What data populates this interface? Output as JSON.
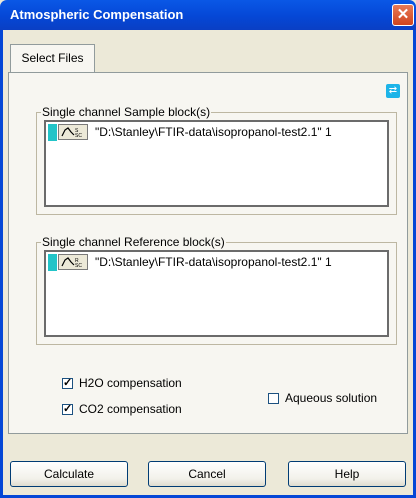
{
  "window": {
    "title": "Atmospheric Compensation",
    "close_glyph": "✕"
  },
  "tabs": [
    {
      "label": "Select Files",
      "active": true
    }
  ],
  "sample_group": {
    "label": "Single channel Sample block(s)",
    "item": {
      "block_letters": "SSC",
      "text": "\"D:\\Stanley\\FTIR-data\\isopropanol-test2.1\" 1"
    }
  },
  "reference_group": {
    "label": "Single channel Reference block(s)",
    "item": {
      "block_letters": "RSC",
      "text": "\"D:\\Stanley\\FTIR-data\\isopropanol-test2.1\" 1"
    }
  },
  "options": {
    "h2o": {
      "label": "H2O compensation",
      "checked": true
    },
    "co2": {
      "label": "CO2 compensation",
      "checked": true
    },
    "aqueous": {
      "label": "Aqueous solution",
      "checked": false
    }
  },
  "buttons": {
    "calculate": "Calculate",
    "cancel": "Cancel",
    "help": "Help"
  },
  "colors": {
    "title_bar": "#0547D6",
    "color_tag": "#22C4C8",
    "swap_icon": "#1DB4E8"
  }
}
